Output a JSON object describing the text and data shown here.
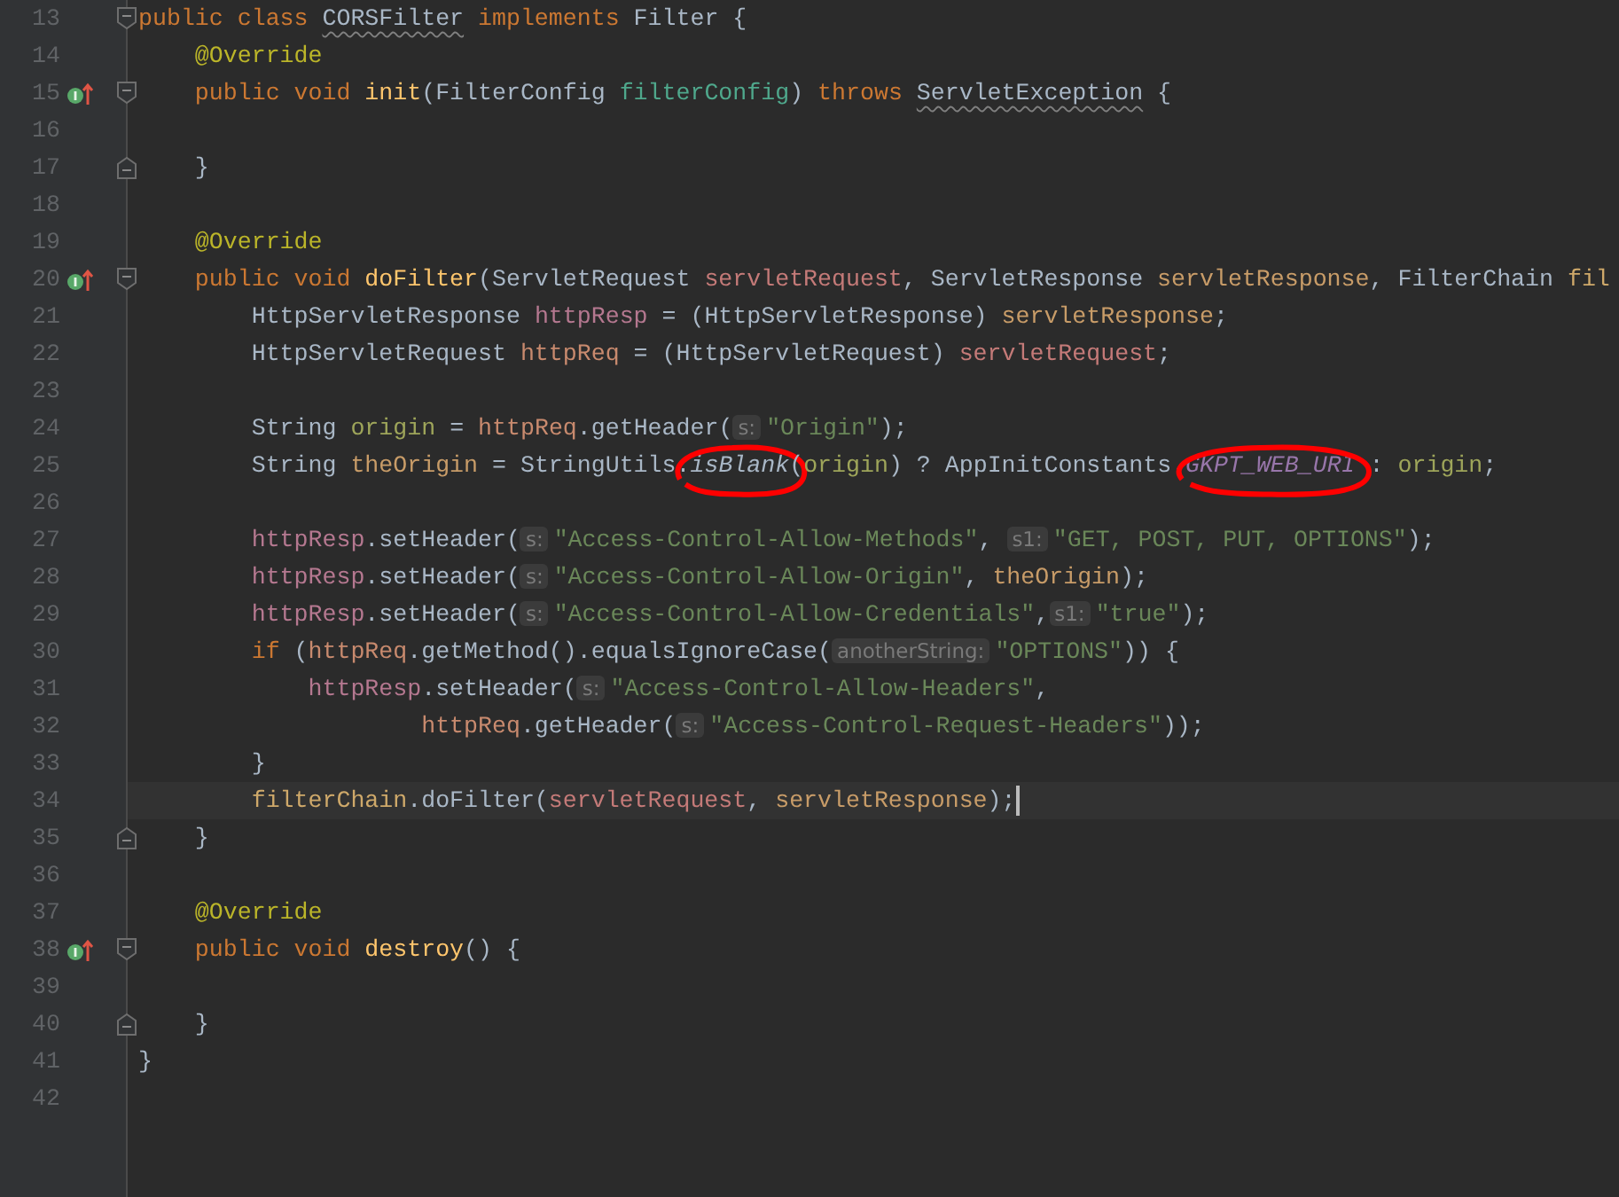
{
  "lines": [
    {
      "number": "13",
      "fold_start": true,
      "tokens": [
        {
          "kind": "keyword",
          "text": "public class "
        },
        {
          "kind": "plain",
          "text": "CORSFilter",
          "warning": true
        },
        {
          "kind": "keyword",
          "text": " implements "
        },
        {
          "kind": "plain",
          "text": "Filter {"
        }
      ]
    },
    {
      "number": "14",
      "tokens": [
        {
          "kind": "annotation",
          "text": "    @Override"
        }
      ]
    },
    {
      "number": "15",
      "override_marker": true,
      "fold_start": true,
      "tokens": [
        {
          "kind": "keyword",
          "text": "    public void "
        },
        {
          "kind": "method",
          "text": "init"
        },
        {
          "kind": "plain",
          "text": "(FilterConfig "
        },
        {
          "kind": "variable",
          "text": "filterConfig",
          "color": "#4fa88c"
        },
        {
          "kind": "plain",
          "text": ") "
        },
        {
          "kind": "keyword",
          "text": "throws "
        },
        {
          "kind": "plain",
          "text": "ServletException",
          "warning": true
        },
        {
          "kind": "plain",
          "text": " {"
        }
      ]
    },
    {
      "number": "16"
    },
    {
      "number": "17",
      "fold_end": true,
      "tokens": [
        {
          "kind": "plain",
          "text": "    }"
        }
      ]
    },
    {
      "number": "18"
    },
    {
      "number": "19",
      "tokens": [
        {
          "kind": "annotation",
          "text": "    @Override"
        }
      ]
    },
    {
      "number": "20",
      "override_marker": true,
      "fold_start": true,
      "tokens": [
        {
          "kind": "keyword",
          "text": "    public void "
        },
        {
          "kind": "method",
          "text": "doFilter"
        },
        {
          "kind": "plain",
          "text": "(ServletRequest "
        },
        {
          "kind": "variable",
          "text": "servletRequest",
          "color": "#c47a78"
        },
        {
          "kind": "plain",
          "text": ", ServletResponse "
        },
        {
          "kind": "variable",
          "text": "servletResponse",
          "color": "#c89c68"
        },
        {
          "kind": "plain",
          "text": ", FilterChain "
        },
        {
          "kind": "variable",
          "text": "fil",
          "color": "#cfa96a"
        }
      ]
    },
    {
      "number": "21",
      "tokens": [
        {
          "kind": "plain",
          "text": "        HttpServletResponse "
        },
        {
          "kind": "variable",
          "text": "httpResp",
          "color": "#b57890"
        },
        {
          "kind": "plain",
          "text": " = (HttpServletResponse) "
        },
        {
          "kind": "variable",
          "text": "servletResponse",
          "color": "#c89c68"
        },
        {
          "kind": "plain",
          "text": ";"
        }
      ]
    },
    {
      "number": "22",
      "tokens": [
        {
          "kind": "plain",
          "text": "        HttpServletRequest "
        },
        {
          "kind": "variable",
          "text": "httpReq",
          "color": "#c88a6e"
        },
        {
          "kind": "plain",
          "text": " = (HttpServletRequest) "
        },
        {
          "kind": "variable",
          "text": "servletRequest",
          "color": "#c47a78"
        },
        {
          "kind": "plain",
          "text": ";"
        }
      ]
    },
    {
      "number": "23"
    },
    {
      "number": "24",
      "tokens": [
        {
          "kind": "plain",
          "text": "        String "
        },
        {
          "kind": "variable",
          "text": "origin",
          "color": "#9ea55a"
        },
        {
          "kind": "plain",
          "text": " = "
        },
        {
          "kind": "variable",
          "text": "httpReq",
          "color": "#c88a6e"
        },
        {
          "kind": "plain",
          "text": ".getHeader("
        },
        {
          "kind": "hint",
          "text": "s:"
        },
        {
          "kind": "string",
          "text": "\"Origin\""
        },
        {
          "kind": "plain",
          "text": ");"
        }
      ]
    },
    {
      "number": "25",
      "tokens": [
        {
          "kind": "plain",
          "text": "        String "
        },
        {
          "kind": "variable",
          "text": "theOrigin",
          "color": "#c89c68"
        },
        {
          "kind": "plain",
          "text": " = StringUtils."
        },
        {
          "kind": "static-method",
          "text": "isBlank",
          "circled": true
        },
        {
          "kind": "plain",
          "text": "("
        },
        {
          "kind": "variable",
          "text": "origin",
          "color": "#9ea55a"
        },
        {
          "kind": "plain",
          "text": ") ? AppInitConstants."
        },
        {
          "kind": "static-field",
          "text": "GKPT_WEB_URI",
          "circled": true
        },
        {
          "kind": "plain",
          "text": " : "
        },
        {
          "kind": "variable",
          "text": "origin",
          "color": "#9ea55a"
        },
        {
          "kind": "plain",
          "text": ";"
        }
      ]
    },
    {
      "number": "26"
    },
    {
      "number": "27",
      "tokens": [
        {
          "kind": "variable",
          "text": "        httpResp",
          "color": "#b57890"
        },
        {
          "kind": "plain",
          "text": ".setHeader("
        },
        {
          "kind": "hint",
          "text": "s:"
        },
        {
          "kind": "string",
          "text": "\"Access-Control-Allow-Methods\""
        },
        {
          "kind": "plain",
          "text": ", "
        },
        {
          "kind": "hint",
          "text": "s1:"
        },
        {
          "kind": "string",
          "text": "\"GET, POST, PUT, OPTIONS\""
        },
        {
          "kind": "plain",
          "text": ");"
        }
      ]
    },
    {
      "number": "28",
      "tokens": [
        {
          "kind": "variable",
          "text": "        httpResp",
          "color": "#b57890"
        },
        {
          "kind": "plain",
          "text": ".setHeader("
        },
        {
          "kind": "hint",
          "text": "s:"
        },
        {
          "kind": "string",
          "text": "\"Access-Control-Allow-Origin\""
        },
        {
          "kind": "plain",
          "text": ", "
        },
        {
          "kind": "variable",
          "text": "theOrigin",
          "color": "#c89c68"
        },
        {
          "kind": "plain",
          "text": ");"
        }
      ]
    },
    {
      "number": "29",
      "tokens": [
        {
          "kind": "variable",
          "text": "        httpResp",
          "color": "#b57890"
        },
        {
          "kind": "plain",
          "text": ".setHeader("
        },
        {
          "kind": "hint",
          "text": "s:"
        },
        {
          "kind": "string",
          "text": "\"Access-Control-Allow-Credentials\""
        },
        {
          "kind": "plain",
          "text": ","
        },
        {
          "kind": "hint",
          "text": "s1:"
        },
        {
          "kind": "string",
          "text": "\"true\""
        },
        {
          "kind": "plain",
          "text": ");"
        }
      ]
    },
    {
      "number": "30",
      "tokens": [
        {
          "kind": "keyword",
          "text": "        if "
        },
        {
          "kind": "plain",
          "text": "("
        },
        {
          "kind": "variable",
          "text": "httpReq",
          "color": "#c88a6e"
        },
        {
          "kind": "plain",
          "text": ".getMethod().equalsIgnoreCase("
        },
        {
          "kind": "hint",
          "text": "anotherString:"
        },
        {
          "kind": "string",
          "text": "\"OPTIONS\""
        },
        {
          "kind": "plain",
          "text": ")) {"
        }
      ]
    },
    {
      "number": "31",
      "tokens": [
        {
          "kind": "variable",
          "text": "            httpResp",
          "color": "#b57890"
        },
        {
          "kind": "plain",
          "text": ".setHeader("
        },
        {
          "kind": "hint",
          "text": "s:"
        },
        {
          "kind": "string",
          "text": "\"Access-Control-Allow-Headers\""
        },
        {
          "kind": "plain",
          "text": ","
        }
      ]
    },
    {
      "number": "32",
      "tokens": [
        {
          "kind": "variable",
          "text": "                    httpReq",
          "color": "#c88a6e"
        },
        {
          "kind": "plain",
          "text": ".getHeader("
        },
        {
          "kind": "hint",
          "text": "s:"
        },
        {
          "kind": "string",
          "text": "\"Access-Control-Request-Headers\""
        },
        {
          "kind": "plain",
          "text": "));"
        }
      ]
    },
    {
      "number": "33",
      "tokens": [
        {
          "kind": "plain",
          "text": "        }"
        }
      ]
    },
    {
      "number": "34",
      "current": true,
      "tokens": [
        {
          "kind": "variable",
          "text": "        filterChain",
          "color": "#cfa96a"
        },
        {
          "kind": "plain",
          "text": ".doFilter("
        },
        {
          "kind": "variable",
          "text": "servletRequest",
          "color": "#c47a78"
        },
        {
          "kind": "plain",
          "text": ", "
        },
        {
          "kind": "variable",
          "text": "servletResponse",
          "color": "#c89c68"
        },
        {
          "kind": "plain",
          "text": ");"
        }
      ]
    },
    {
      "number": "35",
      "fold_end": true,
      "tokens": [
        {
          "kind": "plain",
          "text": "    }"
        }
      ]
    },
    {
      "number": "36"
    },
    {
      "number": "37",
      "tokens": [
        {
          "kind": "annotation",
          "text": "    @Override"
        }
      ]
    },
    {
      "number": "38",
      "override_marker": true,
      "fold_start": true,
      "tokens": [
        {
          "kind": "keyword",
          "text": "    public void "
        },
        {
          "kind": "method",
          "text": "destroy"
        },
        {
          "kind": "plain",
          "text": "() {"
        }
      ]
    },
    {
      "number": "39"
    },
    {
      "number": "40",
      "fold_end": true,
      "tokens": [
        {
          "kind": "plain",
          "text": "    }"
        }
      ]
    },
    {
      "number": "41",
      "tokens": [
        {
          "kind": "plain",
          "text": "}"
        }
      ]
    },
    {
      "number": "42"
    }
  ]
}
